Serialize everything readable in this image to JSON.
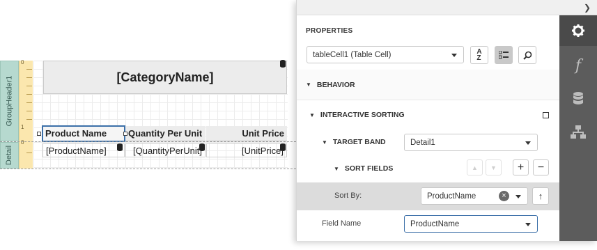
{
  "designer": {
    "bands": {
      "group_header": "GroupHeader1",
      "detail": "Detail"
    },
    "ruler": {
      "ticks": [
        "0",
        "1",
        "0"
      ]
    },
    "category_field": "[CategoryName]",
    "table_headers": [
      "Product Name",
      "Quantity Per Unit",
      "Unit Price"
    ],
    "table_cells": [
      "[ProductName]",
      "[QuantityPerUnit]",
      "[UnitPrice]"
    ]
  },
  "panel": {
    "title": "PROPERTIES",
    "selected_component": "tableCell1 (Table Cell)",
    "sections": {
      "behavior": "BEHAVIOR",
      "interactive_sorting": "INTERACTIVE SORTING",
      "target_band": "TARGET BAND",
      "sort_fields": "SORT FIELDS"
    },
    "target_band_value": "Detail1",
    "sort_by_label": "Sort By:",
    "sort_by_value": "ProductName",
    "field_name_label": "Field Name",
    "field_name_value": "ProductName",
    "strip_icons": [
      "gear-icon",
      "function-icon",
      "database-icon",
      "hierarchy-icon"
    ]
  },
  "colors": {
    "accent": "#3b6fa8",
    "strip_bg": "#5c5c5c",
    "band_strip": "#b6d9cf",
    "ruler": "#fbe7ae"
  }
}
